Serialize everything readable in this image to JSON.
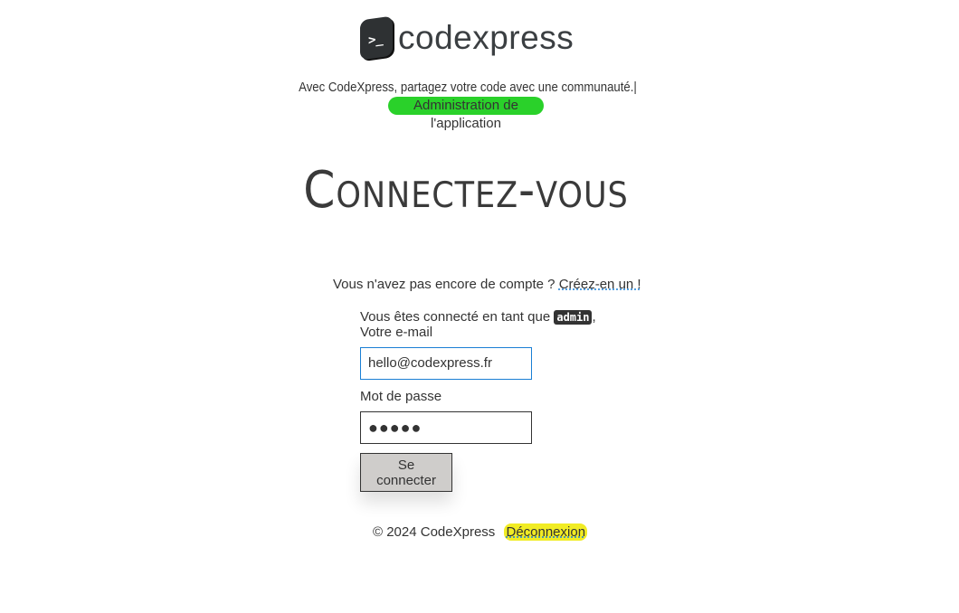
{
  "header": {
    "logo_text": "codexpress",
    "tagline": "Avec CodeXpress, partagez votre code avec une communauté.|",
    "admin_link": "Administration de l'application"
  },
  "main": {
    "title": "Connectez-vous",
    "signup_prompt": "Vous n'avez pas encore de compte ?",
    "signup_link": "Créez-en un !",
    "logged_in_prefix": "Vous êtes connecté en tant que",
    "username": "admin",
    "logged_in_suffix": ",",
    "email_label": "Votre e-mail",
    "email_value": "hello@codexpress.fr",
    "password_label": "Mot de passe",
    "password_value": "●●●●●",
    "submit_label": "Se connecter"
  },
  "footer": {
    "copyright": "© 2024 CodeXpress",
    "logout_link": "Déconnexion"
  }
}
